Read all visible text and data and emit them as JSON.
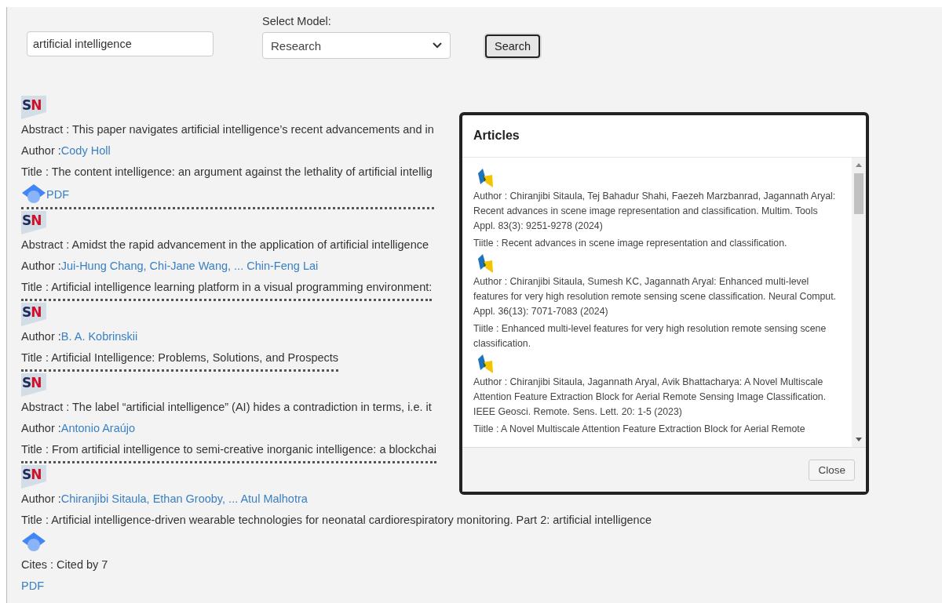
{
  "search": {
    "value": "artificial intelligence",
    "model_label": "Select Model:",
    "model_value": "Research",
    "button": "Search"
  },
  "results": [
    {
      "logo": [
        "S",
        "N"
      ],
      "abstract": "Abstract : This paper navigates artificial intelligence’s recent advancements and in",
      "author_label": "Author :",
      "authors": "Cody Holl",
      "title": "Title : The content intelligence: an argument against the lethality of artificial intellig",
      "extras": [
        {
          "kind": "scholar-pdf",
          "label": "PDF"
        }
      ]
    },
    {
      "logo": [
        "S",
        "N"
      ],
      "abstract": "Abstract : Amidst the rapid advancement in the application of artificial intelligence",
      "author_label": "Author :",
      "authors": "Jui-Hung Chang, Chi-Jane Wang, ... Chin-Feng Lai",
      "title": "Title : Artificial intelligence learning platform in a visual programming environment:"
    },
    {
      "logo": [
        "S",
        "N"
      ],
      "author_label": "Author :",
      "authors": "B. A. Kobrinskii",
      "title": "Title : Artificial Intelligence: Problems, Solutions, and Prospects"
    },
    {
      "logo": [
        "S",
        "N"
      ],
      "abstract": "Abstract : The label “artificial intelligence” (AI) hides a contradiction in terms, i.e. it",
      "author_label": "Author :",
      "authors": "Antonio Araújo",
      "title": "Title : From artificial intelligence to semi-creative inorganic intelligence: a blockchai"
    },
    {
      "logo": [
        "S",
        "N"
      ],
      "author_label": "Author :",
      "authors": "Chiranjibi Sitaula, Ethan Grooby, ... Atul Malhotra",
      "title": "Title : Artificial intelligence-driven wearable technologies for neonatal cardiorespiratory monitoring. Part 2: artificial intelligence",
      "extras": [
        {
          "kind": "scholar"
        },
        {
          "kind": "cites",
          "text": "Cites : Cited by 7"
        },
        {
          "kind": "pdf",
          "label": "PDF"
        }
      ]
    }
  ],
  "modal": {
    "title": "Articles",
    "close": "Close",
    "articles": [
      {
        "author": "Author : Chiranjibi Sitaula, Tej Bahadur Shahi, Faezeh Marzbanrad, Jagannath Aryal: Recent advances in scene image representation and classification. Multim. Tools Appl. 83(3): 9251-9278 (2024)",
        "title": "Tiitle : Recent advances in scene image representation and classification."
      },
      {
        "author": "Author : Chiranjibi Sitaula, Sumesh KC, Jagannath Aryal: Enhanced multi-level features for very high resolution remote sensing scene classification. Neural Comput. Appl. 36(13): 7071-7083 (2024)",
        "title": "Tiitle : Enhanced multi-level features for very high resolution remote sensing scene classification."
      },
      {
        "author": "Author : Chiranjibi Sitaula, Jagannath Aryal, Avik Bhattacharya: A Novel Multiscale Attention Feature Extraction Block for Aerial Remote Sensing Image Classification. IEEE Geosci. Remote. Sens. Lett. 20: 1-5 (2023)",
        "title": "Tiitle : A Novel Multiscale Attention Feature Extraction Block for Aerial Remote"
      }
    ]
  }
}
